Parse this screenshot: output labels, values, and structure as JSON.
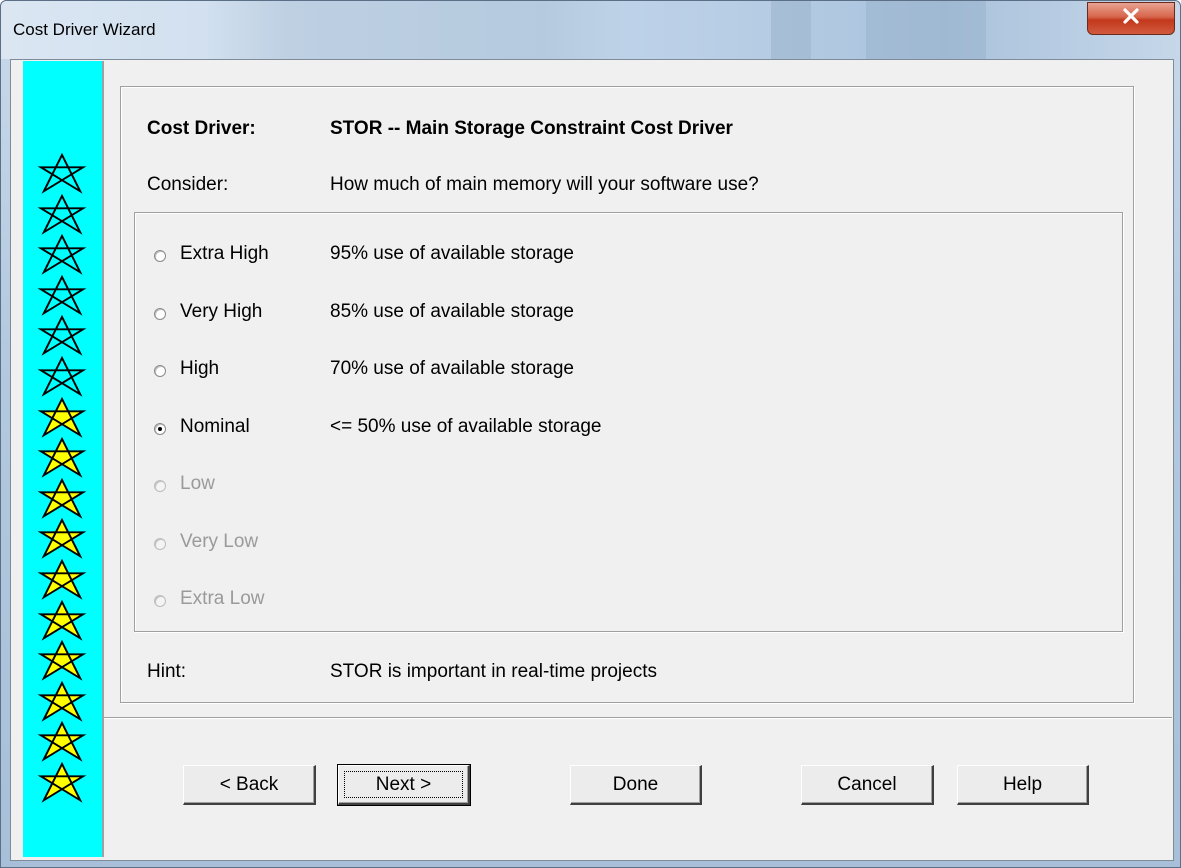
{
  "window": {
    "title": "Cost Driver Wizard",
    "close_icon": "close-icon"
  },
  "stars": {
    "total": 16,
    "outlined": 6,
    "filled": 10,
    "colors": {
      "strip": "#00ffff",
      "filled_star": "#ffff00",
      "star_outline": "#000000"
    }
  },
  "header": {
    "cost_driver_label": "Cost Driver:",
    "cost_driver_value": "STOR -- Main Storage Constraint Cost Driver",
    "consider_label": "Consider:",
    "consider_value": "How much of main memory will your software use?"
  },
  "ratings": [
    {
      "label": "Extra High",
      "description": "95% use of available storage",
      "selected": false,
      "enabled": true
    },
    {
      "label": "Very High",
      "description": "85% use of available storage",
      "selected": false,
      "enabled": true
    },
    {
      "label": "High",
      "description": "70% use of available storage",
      "selected": false,
      "enabled": true
    },
    {
      "label": "Nominal",
      "description": "<= 50% use of available storage",
      "selected": true,
      "enabled": true
    },
    {
      "label": "Low",
      "description": "",
      "selected": false,
      "enabled": false
    },
    {
      "label": "Very Low",
      "description": "",
      "selected": false,
      "enabled": false
    },
    {
      "label": "Extra Low",
      "description": "",
      "selected": false,
      "enabled": false
    }
  ],
  "hint": {
    "label": "Hint:",
    "value": "STOR is important in real-time projects"
  },
  "buttons": {
    "back": "< Back",
    "next": "Next >",
    "done": "Done",
    "cancel": "Cancel",
    "help": "Help"
  }
}
